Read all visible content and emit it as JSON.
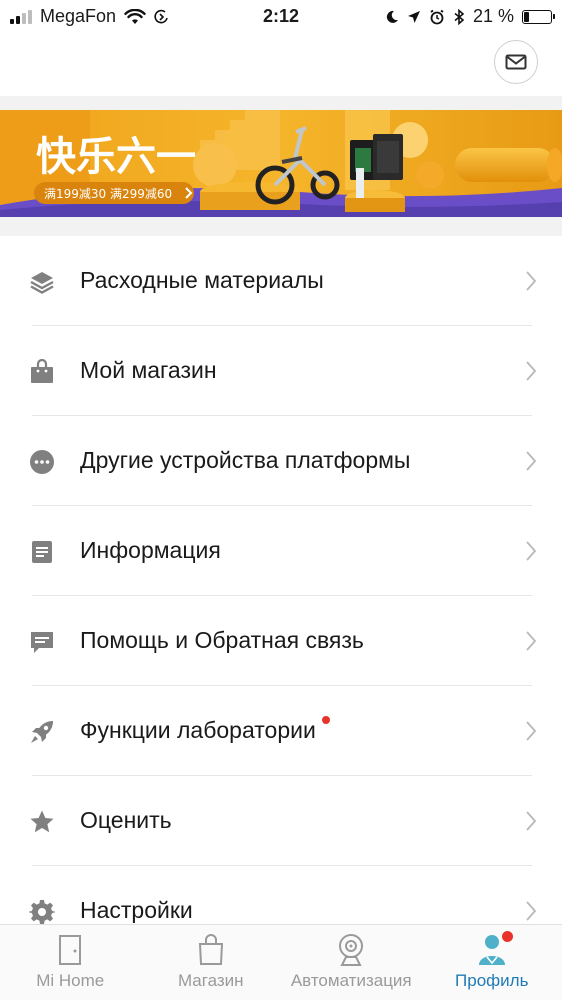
{
  "status_bar": {
    "carrier": "MegaFon",
    "time": "2:12",
    "battery_percent": "21 %",
    "battery_level": 0.21
  },
  "header": {
    "mail_icon": "mail-icon"
  },
  "banner": {
    "title": "快乐六一",
    "promo": "满199减30  满299减60",
    "colors": {
      "orange": "#f2a516",
      "purple": "#6a4ec8"
    }
  },
  "menu": {
    "items": [
      {
        "label": "Расходные материалы",
        "icon": "layers-icon"
      },
      {
        "label": "Мой магазин",
        "icon": "shopping-bag-icon"
      },
      {
        "label": "Другие устройства платформы",
        "icon": "more-dots-icon"
      },
      {
        "label": "Информация",
        "icon": "document-icon"
      },
      {
        "label": "Помощь и Обратная связь",
        "icon": "chat-icon"
      },
      {
        "label": "Функции лаборатории",
        "icon": "rocket-icon",
        "badge": true
      },
      {
        "label": "Оценить",
        "icon": "star-icon"
      },
      {
        "label": "Настройки",
        "icon": "gear-icon"
      }
    ]
  },
  "tabbar": {
    "tabs": [
      {
        "label": "Mi Home",
        "icon": "door-icon"
      },
      {
        "label": "Магазин",
        "icon": "shopping-bag-icon"
      },
      {
        "label": "Автоматизация",
        "icon": "camera-icon"
      },
      {
        "label": "Профиль",
        "icon": "profile-icon",
        "active": true,
        "badge": true
      }
    ],
    "colors": {
      "active": "#1f7bb6",
      "inactive": "#9a9a9a"
    }
  }
}
